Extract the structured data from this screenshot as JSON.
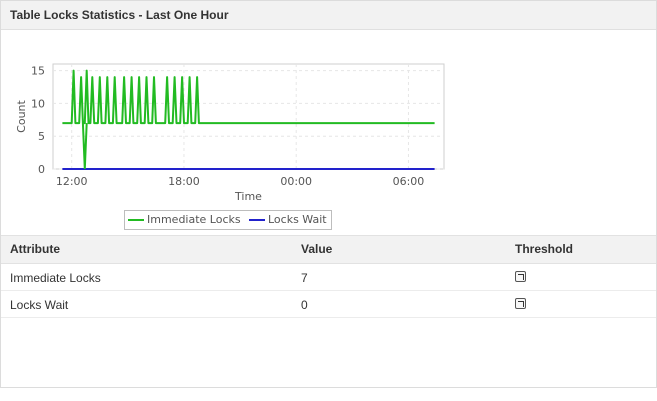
{
  "header": {
    "title": "Table Locks Statistics - Last One Hour"
  },
  "table": {
    "columns": [
      "Attribute",
      "Value",
      "Threshold"
    ],
    "rows": [
      {
        "attribute": "Immediate Locks",
        "value": "7",
        "threshold_icon": "threshold-edit-icon"
      },
      {
        "attribute": "Locks Wait",
        "value": "0",
        "threshold_icon": "threshold-edit-icon"
      }
    ]
  },
  "chart_data": {
    "type": "line",
    "xlabel": "Time",
    "ylabel": "Count",
    "x_unit": "hour of day (starting 11:00)",
    "xlim": [
      11.0,
      31.9
    ],
    "ylim": [
      0,
      16
    ],
    "x_tick_labels": [
      "12:00",
      "18:00",
      "00:00",
      "06:00"
    ],
    "x_ticks": [
      12,
      18,
      24,
      30
    ],
    "y_ticks": [
      0,
      5,
      10,
      15
    ],
    "grid": true,
    "legend_position": "bottom",
    "series": [
      {
        "name": "Immediate Locks",
        "color": "#22bb22",
        "points": [
          [
            11.5,
            7
          ],
          [
            12.0,
            7
          ],
          [
            12.1,
            15
          ],
          [
            12.2,
            7
          ],
          [
            12.4,
            7
          ],
          [
            12.5,
            14
          ],
          [
            12.6,
            7
          ],
          [
            12.7,
            7
          ],
          [
            12.8,
            15
          ],
          [
            12.9,
            7
          ],
          [
            13.0,
            7
          ],
          [
            13.1,
            14
          ],
          [
            13.2,
            7
          ],
          [
            13.4,
            7
          ],
          [
            13.5,
            14
          ],
          [
            13.6,
            7
          ],
          [
            13.8,
            7
          ],
          [
            13.9,
            14
          ],
          [
            14.0,
            7
          ],
          [
            14.2,
            7
          ],
          [
            14.3,
            14
          ],
          [
            14.4,
            7
          ],
          [
            14.7,
            7
          ],
          [
            14.8,
            14
          ],
          [
            14.9,
            7
          ],
          [
            15.1,
            7
          ],
          [
            15.2,
            14
          ],
          [
            15.3,
            7
          ],
          [
            15.5,
            7
          ],
          [
            15.6,
            14
          ],
          [
            15.7,
            7
          ],
          [
            15.9,
            7
          ],
          [
            16.0,
            14
          ],
          [
            16.1,
            7
          ],
          [
            16.3,
            7
          ],
          [
            16.4,
            14
          ],
          [
            16.5,
            7
          ],
          [
            17.0,
            7
          ],
          [
            17.1,
            14
          ],
          [
            17.2,
            7
          ],
          [
            17.4,
            7
          ],
          [
            17.5,
            14
          ],
          [
            17.6,
            7
          ],
          [
            17.8,
            7
          ],
          [
            17.9,
            14
          ],
          [
            18.0,
            7
          ],
          [
            18.2,
            7
          ],
          [
            18.3,
            14
          ],
          [
            18.4,
            7
          ],
          [
            18.6,
            7
          ],
          [
            18.7,
            14
          ],
          [
            18.8,
            7
          ],
          [
            31.4,
            7
          ]
        ]
      },
      {
        "name": "Locks Wait",
        "color": "#2222cc",
        "points": [
          [
            11.5,
            0
          ],
          [
            31.4,
            0
          ]
        ]
      }
    ],
    "dip_from_immediate": [
      [
        12.6,
        7
      ],
      [
        12.7,
        0
      ],
      [
        12.8,
        7
      ]
    ]
  }
}
